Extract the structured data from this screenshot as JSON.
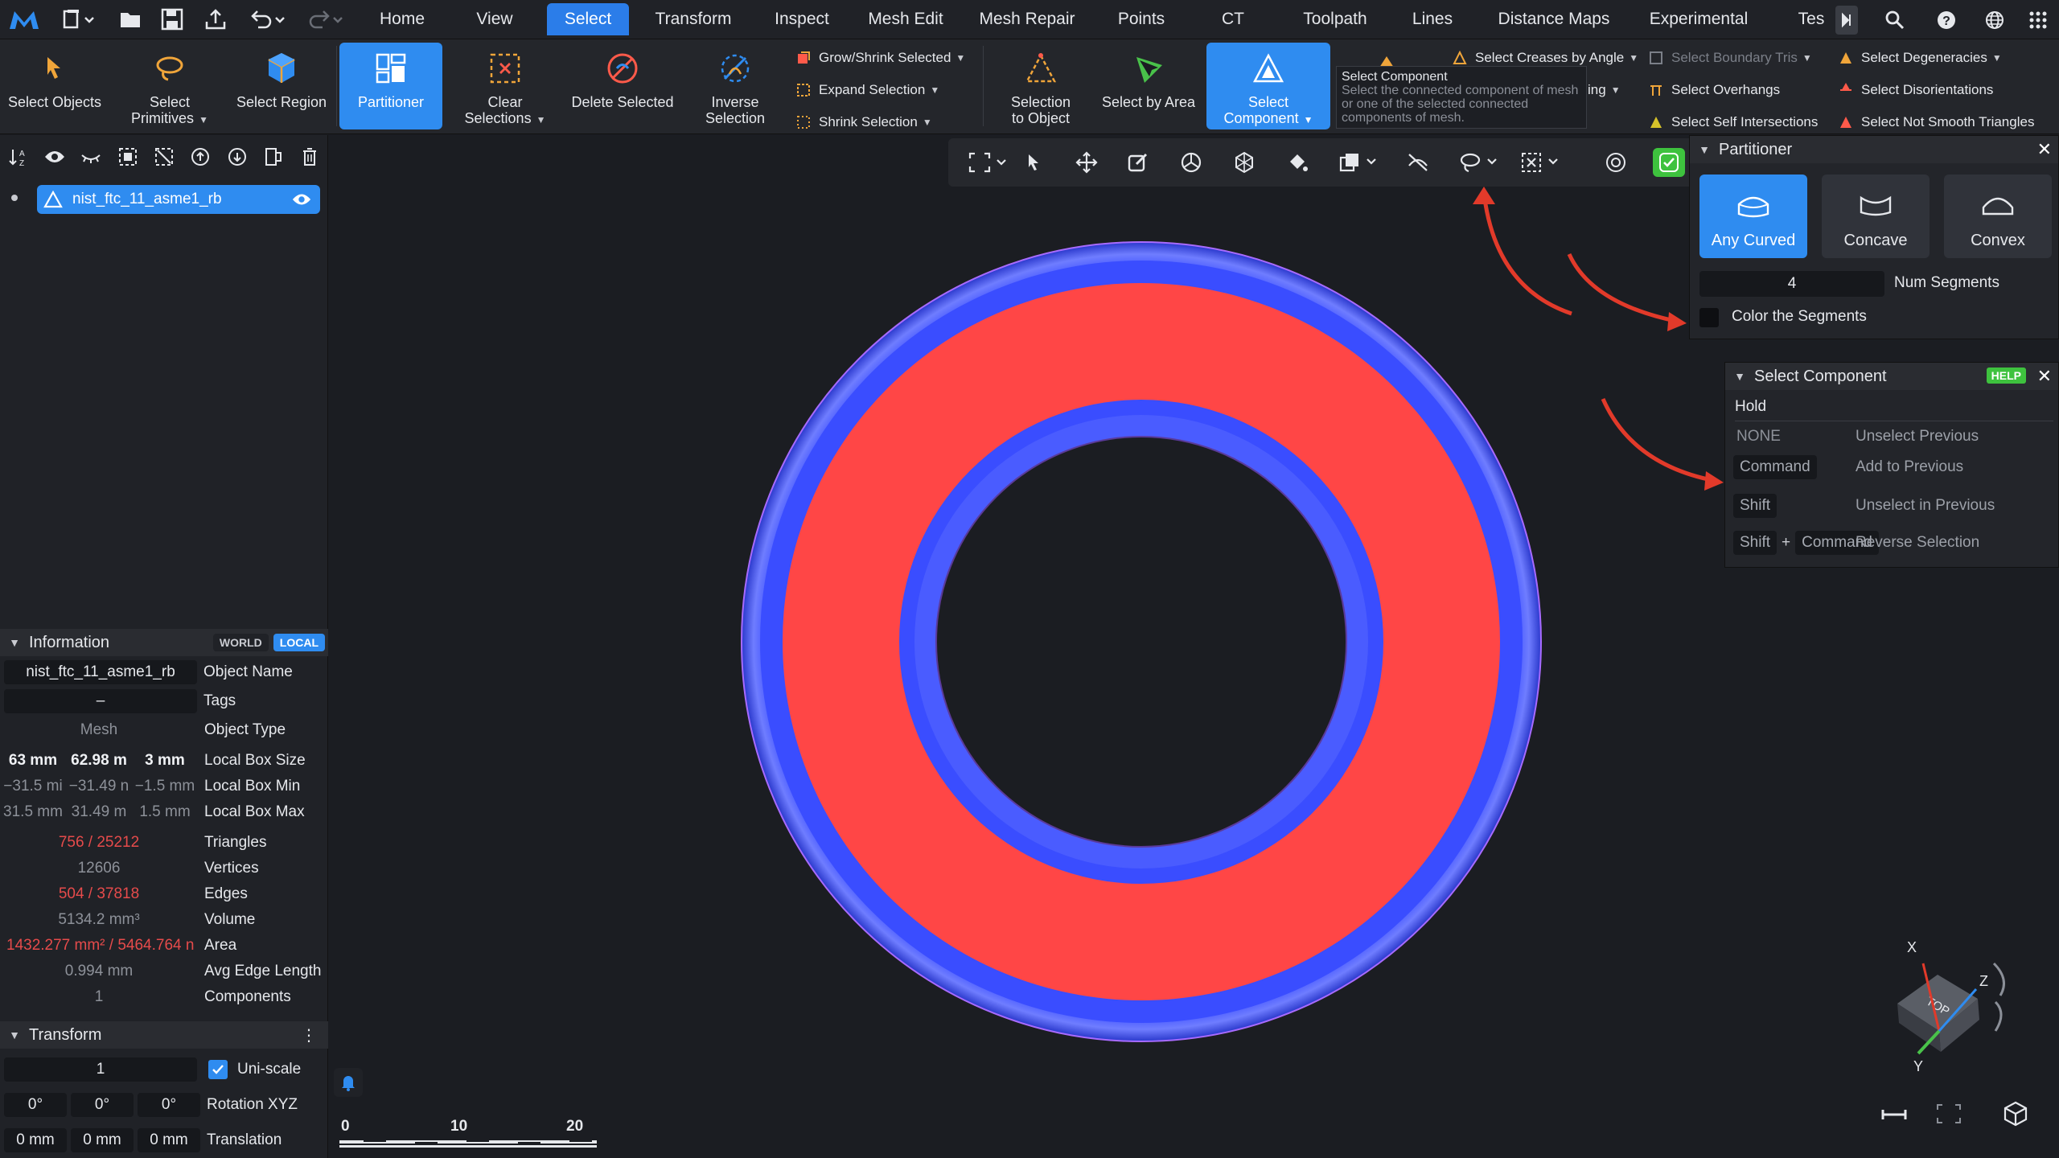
{
  "menubar": {
    "tabs": [
      "Home",
      "View",
      "Select",
      "Transform",
      "Inspect",
      "Mesh Edit",
      "Mesh Repair",
      "Points",
      "CT",
      "Toolpath",
      "Lines",
      "Distance Maps",
      "Experimental",
      "Tes"
    ],
    "active_tab": "Select"
  },
  "ribbon": {
    "select_objects": "Select Objects",
    "select_primitives_1": "Select",
    "select_primitives_2": "Primitives",
    "select_region": "Select Region",
    "partitioner": "Partitioner",
    "clear_selections_1": "Clear",
    "clear_selections_2": "Selections",
    "delete_selected": "Delete Selected",
    "inverse_selection_1": "Inverse",
    "inverse_selection_2": "Selection",
    "grow_shrink": "Grow/Shrink Selected",
    "expand_selection": "Expand Selection",
    "shrink_selection": "Shrink Selection",
    "selection_to_object_1": "Selection",
    "selection_to_object_2": "to Object",
    "select_by_area": "Select by Area",
    "select_component_1": "Select",
    "select_component_2": "Component",
    "select_creases": "Select Creases by Angle",
    "select_boundary_tris": "Select Boundary Tris",
    "select_degeneracies": "Select Degeneracies",
    "partial_ing": "ing",
    "select_overhangs": "Select Overhangs",
    "select_disorientations": "Select Disorientations",
    "select_self_intersections": "Select Self Intersections",
    "select_not_smooth": "Select Not Smooth Triangles"
  },
  "tooltip": {
    "title": "Select Component",
    "text": "Select the connected component of mesh or one of the selected connected components of mesh."
  },
  "scene": {
    "object_name": "nist_ftc_11_asme1_rb"
  },
  "information": {
    "title": "Information",
    "world": "WORLD",
    "local": "LOCAL",
    "object_name": "nist_ftc_11_asme1_rb",
    "object_name_label": "Object Name",
    "tags": "–",
    "tags_label": "Tags",
    "object_type": "Mesh",
    "object_type_label": "Object Type",
    "box_size": [
      "63 mm",
      "62.98 m",
      "3 mm"
    ],
    "box_size_label": "Local Box Size",
    "box_min": [
      "−31.5 mi",
      "−31.49 n",
      "−1.5 mm"
    ],
    "box_min_label": "Local Box Min",
    "box_max": [
      "31.5 mm",
      "31.49 m",
      "1.5 mm"
    ],
    "box_max_label": "Local Box Max",
    "triangles": "756 / 25212",
    "triangles_label": "Triangles",
    "vertices": "12606",
    "vertices_label": "Vertices",
    "edges": "504 / 37818",
    "edges_label": "Edges",
    "volume": "5134.2 mm³",
    "volume_label": "Volume",
    "area": "1432.277 mm² / 5464.764 n",
    "area_label": "Area",
    "avg_edge": "0.994 mm",
    "avg_edge_label": "Avg Edge Length",
    "components": "1",
    "components_label": "Components"
  },
  "transform": {
    "title": "Transform",
    "scale": "1",
    "uniscale_label": "Uni-scale",
    "rotation": [
      "0°",
      "0°",
      "0°"
    ],
    "rotation_label": "Rotation XYZ",
    "translation": [
      "0 mm",
      "0 mm",
      "0 mm"
    ],
    "translation_label": "Translation"
  },
  "partitioner": {
    "title": "Partitioner",
    "modes": [
      "Any Curved",
      "Concave",
      "Convex"
    ],
    "active_mode": "Any Curved",
    "num_segments": "4",
    "num_segments_label": "Num Segments",
    "color_segments_label": "Color the Segments",
    "color_segments_checked": false
  },
  "select_component": {
    "title": "Select Component",
    "help": "HELP",
    "hold": "Hold",
    "rows": [
      {
        "key1": "NONE",
        "plus": "",
        "key2": "",
        "desc": "Unselect Previous"
      },
      {
        "key1": "Command",
        "plus": "",
        "key2": "",
        "desc": "Add to Previous"
      },
      {
        "key1": "Shift",
        "plus": "",
        "key2": "",
        "desc": "Unselect in Previous"
      },
      {
        "key1": "Shift",
        "plus": "+",
        "key2": "Command",
        "desc": "Reverse Selection"
      }
    ]
  },
  "scalebar": {
    "ticks": [
      "0",
      "10",
      "20"
    ]
  },
  "gizmo": {
    "x_label": "X",
    "y_label": "Y",
    "z_label": "Z",
    "face_label": "TOP"
  },
  "colors": {
    "accent": "#2f8cf0",
    "mesh_blue": "#3a4dff",
    "mesh_red": "#ff4646",
    "annotation_arrow": "#e23a2a",
    "highlight_red": "#e64b4b"
  }
}
